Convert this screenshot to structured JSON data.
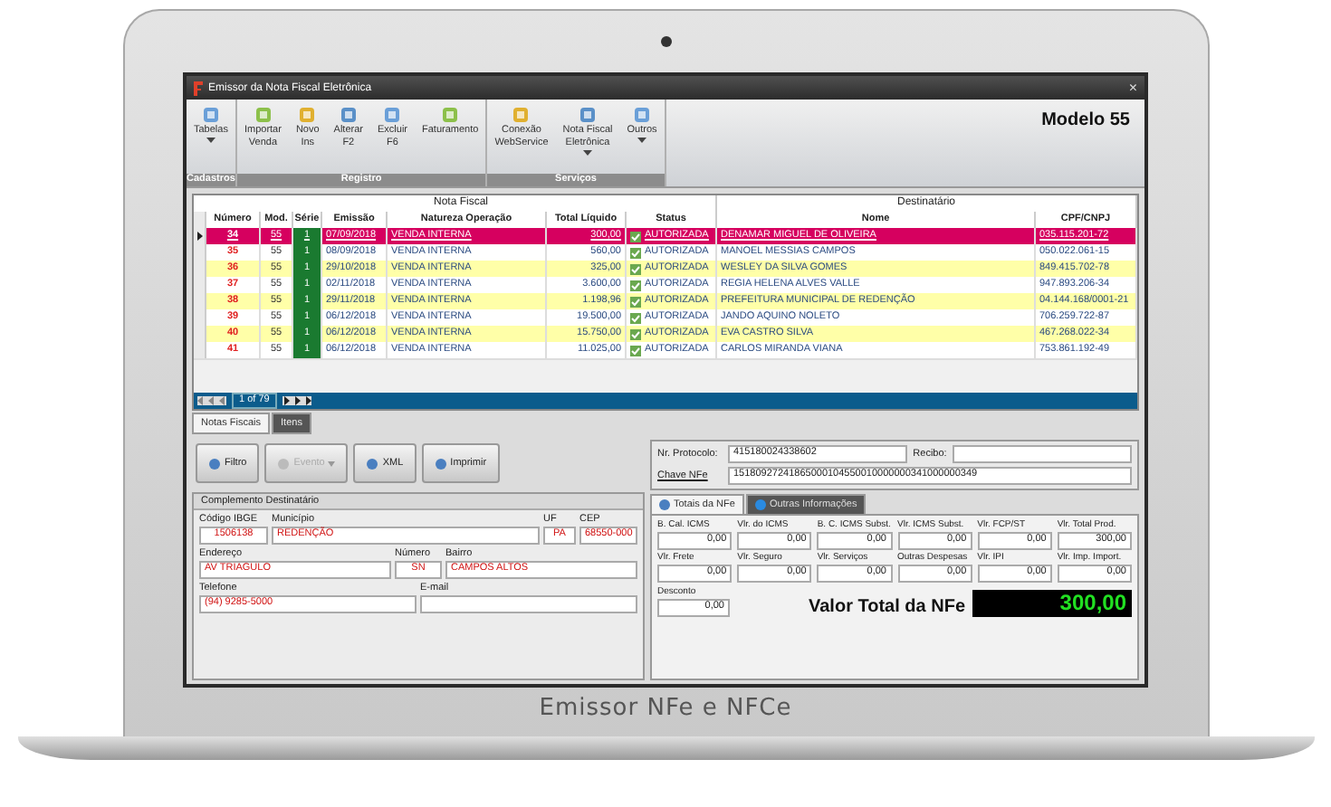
{
  "window": {
    "title": "Emissor da Nota Fiscal Eletrônica",
    "close": "×"
  },
  "ribbon": {
    "groups": [
      {
        "label": "Cadastros",
        "buttons": [
          {
            "lines": [
              "Tabelas"
            ],
            "dropdown": true
          }
        ]
      },
      {
        "label": "Registro",
        "buttons": [
          {
            "lines": [
              "Importar",
              "Venda"
            ],
            "dropdown": false
          },
          {
            "lines": [
              "Novo",
              "Ins"
            ],
            "dropdown": false
          },
          {
            "lines": [
              "Alterar",
              "F2"
            ],
            "dropdown": false
          },
          {
            "lines": [
              "Excluir",
              "F6"
            ],
            "dropdown": false
          },
          {
            "lines": [
              "Faturamento"
            ],
            "dropdown": false
          }
        ]
      },
      {
        "label": "Serviços",
        "buttons": [
          {
            "lines": [
              "Conexão",
              "WebService"
            ],
            "dropdown": false
          },
          {
            "lines": [
              "Nota Fiscal",
              "Eletrônica"
            ],
            "dropdown": true
          },
          {
            "lines": [
              "Outros"
            ],
            "dropdown": true
          }
        ]
      }
    ],
    "model": "Modelo 55"
  },
  "table": {
    "groups": [
      {
        "label": "Nota Fiscal",
        "columns": [
          {
            "label": "Número",
            "kind": "number"
          },
          {
            "label": "Mod.",
            "kind": "center"
          },
          {
            "label": "Série",
            "kind": "serie"
          },
          {
            "label": "Emissão",
            "kind": "date"
          },
          {
            "label": "Natureza Operação",
            "kind": "text"
          },
          {
            "label": "Total Líquido",
            "kind": "money"
          },
          {
            "label": "Status",
            "kind": "status"
          }
        ]
      },
      {
        "label": "Destinatário",
        "columns": [
          {
            "label": "Nome",
            "kind": "text"
          },
          {
            "label": "CPF/CNPJ",
            "kind": "text"
          }
        ]
      }
    ],
    "rows": [
      {
        "selected": true,
        "cells": [
          "34",
          "55",
          "1",
          "07/09/2018",
          "VENDA INTERNA",
          "300,00",
          "AUTORIZADA",
          "DENAMAR MIGUEL DE OLIVEIRA",
          "035.115.201-72"
        ]
      },
      {
        "selected": false,
        "cells": [
          "35",
          "55",
          "1",
          "08/09/2018",
          "VENDA INTERNA",
          "560,00",
          "AUTORIZADA",
          "MANOEL MESSIAS CAMPOS",
          "050.022.061-15"
        ]
      },
      {
        "selected": false,
        "cells": [
          "36",
          "55",
          "1",
          "29/10/2018",
          "VENDA INTERNA",
          "325,00",
          "AUTORIZADA",
          "WESLEY DA SILVA GOMES",
          "849.415.702-78"
        ]
      },
      {
        "selected": false,
        "cells": [
          "37",
          "55",
          "1",
          "02/11/2018",
          "VENDA INTERNA",
          "3.600,00",
          "AUTORIZADA",
          "REGIA HELENA ALVES VALLE",
          "947.893.206-34"
        ]
      },
      {
        "selected": false,
        "cells": [
          "38",
          "55",
          "1",
          "29/11/2018",
          "VENDA INTERNA",
          "1.198,96",
          "AUTORIZADA",
          "PREFEITURA MUNICIPAL DE REDENÇÃO",
          "04.144.168/0001-21"
        ]
      },
      {
        "selected": false,
        "cells": [
          "39",
          "55",
          "1",
          "06/12/2018",
          "VENDA INTERNA",
          "19.500,00",
          "AUTORIZADA",
          "JANDO AQUINO NOLETO",
          "706.259.722-87"
        ]
      },
      {
        "selected": false,
        "cells": [
          "40",
          "55",
          "1",
          "06/12/2018",
          "VENDA INTERNA",
          "15.750,00",
          "AUTORIZADA",
          "EVA CASTRO SILVA",
          "467.268.022-34"
        ]
      },
      {
        "selected": false,
        "cells": [
          "41",
          "55",
          "1",
          "06/12/2018",
          "VENDA INTERNA",
          "11.025,00",
          "AUTORIZADA",
          "CARLOS MIRANDA VIANA",
          "753.861.192-49"
        ]
      }
    ],
    "pager": "1 of 79"
  },
  "tabs": [
    {
      "label": "Notas Fiscais",
      "selected": true
    },
    {
      "label": "Itens",
      "selected": false
    }
  ],
  "actions": [
    {
      "label": "Filtro",
      "disabled": false,
      "dropdown": false
    },
    {
      "label": "Evento",
      "disabled": true,
      "dropdown": true
    },
    {
      "label": "XML",
      "disabled": false,
      "dropdown": false
    },
    {
      "label": "Imprimir",
      "disabled": false,
      "dropdown": false
    }
  ],
  "protocol": {
    "protocol_label": "Nr. Protocolo:",
    "protocol": "415180024338602",
    "receipt_label": "Recibo:",
    "key_label": "Chave NFe",
    "key": "15180927241865000104550010000000341000000349"
  },
  "customer": {
    "title": "Complemento Destinatário",
    "rows": [
      [
        {
          "label": "Código IBGE",
          "value": "1506138"
        },
        {
          "label": "Município",
          "value": "REDENÇÃO"
        },
        {
          "label": "UF",
          "value": "PA"
        },
        {
          "label": "CEP",
          "value": "68550-000"
        }
      ],
      [
        {
          "label": "Endereço",
          "value": "AV TRIAGULO"
        },
        {
          "label": "Número",
          "value": "SN"
        },
        {
          "label": "Bairro",
          "value": "CAMPOS ALTOS"
        }
      ],
      [
        {
          "label": "Telefone",
          "value": "(94) 9285-5000"
        },
        {
          "label": "E-mail"
        }
      ]
    ]
  },
  "totals": {
    "tabs": [
      {
        "label": "Totais da NFe",
        "selected": true
      },
      {
        "label": "Outras Informações",
        "selected": false
      }
    ],
    "fields": [
      {
        "label": "B. Cal. ICMS",
        "value": "0,00"
      },
      {
        "label": "Vlr. do ICMS",
        "value": "0,00"
      },
      {
        "label": "B. C. ICMS Subst.",
        "value": "0,00"
      },
      {
        "label": "Vlr. ICMS Subst.",
        "value": "0,00"
      },
      {
        "label": "Vlr. FCP/ST",
        "value": "0,00"
      },
      {
        "label": "Vlr. Total Prod.",
        "value": "300,00"
      },
      {
        "label": "Vlr. Frete",
        "value": "0,00"
      },
      {
        "label": "Vlr. Seguro",
        "value": "0,00"
      },
      {
        "label": "Vlr. Serviços",
        "value": "0,00"
      },
      {
        "label": "Outras Despesas",
        "value": "0,00"
      },
      {
        "label": "Vlr. IPI",
        "value": "0,00"
      },
      {
        "label": "Vlr. Imp. Import.",
        "value": "0,00"
      }
    ],
    "discount": {
      "label": "Desconto",
      "value": "0,00"
    },
    "grand_total": {
      "label": "Valor Total da NFe",
      "value": "300,00"
    }
  },
  "caption": "Emissor NFe e NFCe"
}
